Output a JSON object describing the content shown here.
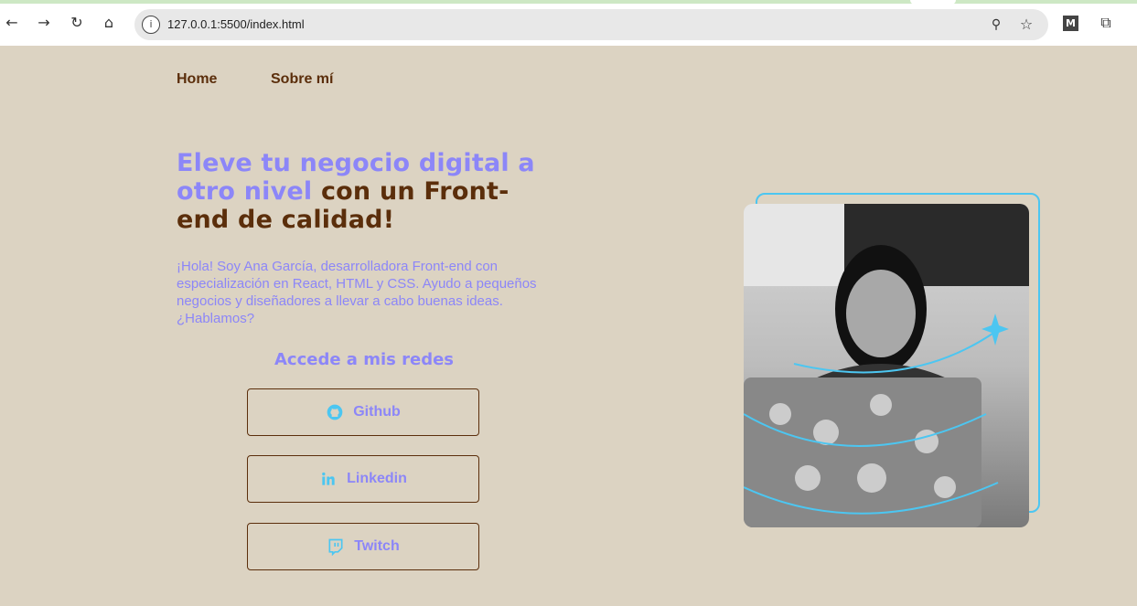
{
  "browser": {
    "url": "127.0.0.1:5500/index.html",
    "profile_letter": "M"
  },
  "nav": {
    "items": [
      "Home",
      "Sobre mí"
    ]
  },
  "hero": {
    "title_highlight": "Eleve tu negocio digital a otro nivel",
    "title_rest": " con un Front-end de calidad!",
    "intro": "¡Hola! Soy Ana García, desarrolladora Front-end con especialización en React, HTML y CSS. Ayudo a pequeños negocios y diseñadores a llevar a cabo buenas ideas. ¿Hablamos?",
    "social_heading": "Accede a mis redes",
    "buttons": [
      {
        "label": "Github",
        "icon": "github-icon"
      },
      {
        "label": "Linkedin",
        "icon": "linkedin-icon"
      },
      {
        "label": "Twitch",
        "icon": "twitch-icon"
      }
    ]
  },
  "colors": {
    "background": "#dcd3c2",
    "accent": "#8c86f8",
    "brown": "#5b2e0b",
    "cyan": "#4cc6f1"
  }
}
